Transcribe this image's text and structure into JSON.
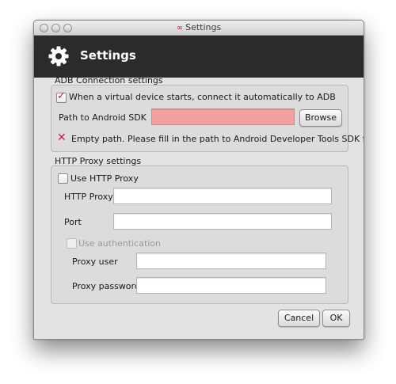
{
  "window": {
    "title": "Settings"
  },
  "header": {
    "title": "Settings",
    "icon": "gear-icon"
  },
  "adb": {
    "group_title": "ADB Connection settings",
    "auto_connect_label": "When a virtual device starts, connect it automatically to ADB",
    "auto_connect_checked": true,
    "sdk_path_label": "Path to Android SDK",
    "sdk_path_value": "",
    "browse_label": "Browse",
    "error_message": "Empty path. Please fill in the path to Android Developer Tools SDK folder"
  },
  "proxy": {
    "group_title": "HTTP Proxy settings",
    "use_proxy_label": "Use HTTP Proxy",
    "use_proxy_checked": false,
    "http_proxy_label": "HTTP Proxy",
    "http_proxy_value": "",
    "port_label": "Port",
    "port_value": "",
    "use_auth_label": "Use authentication",
    "use_auth_checked": false,
    "proxy_user_label": "Proxy user",
    "proxy_user_value": "",
    "proxy_password_label": "Proxy password",
    "proxy_password_value": ""
  },
  "footer": {
    "cancel_label": "Cancel",
    "ok_label": "OK"
  },
  "colors": {
    "header_bg": "#2b2b2b",
    "error_field": "#f5a0a0",
    "accent_red": "#d51a3e"
  }
}
